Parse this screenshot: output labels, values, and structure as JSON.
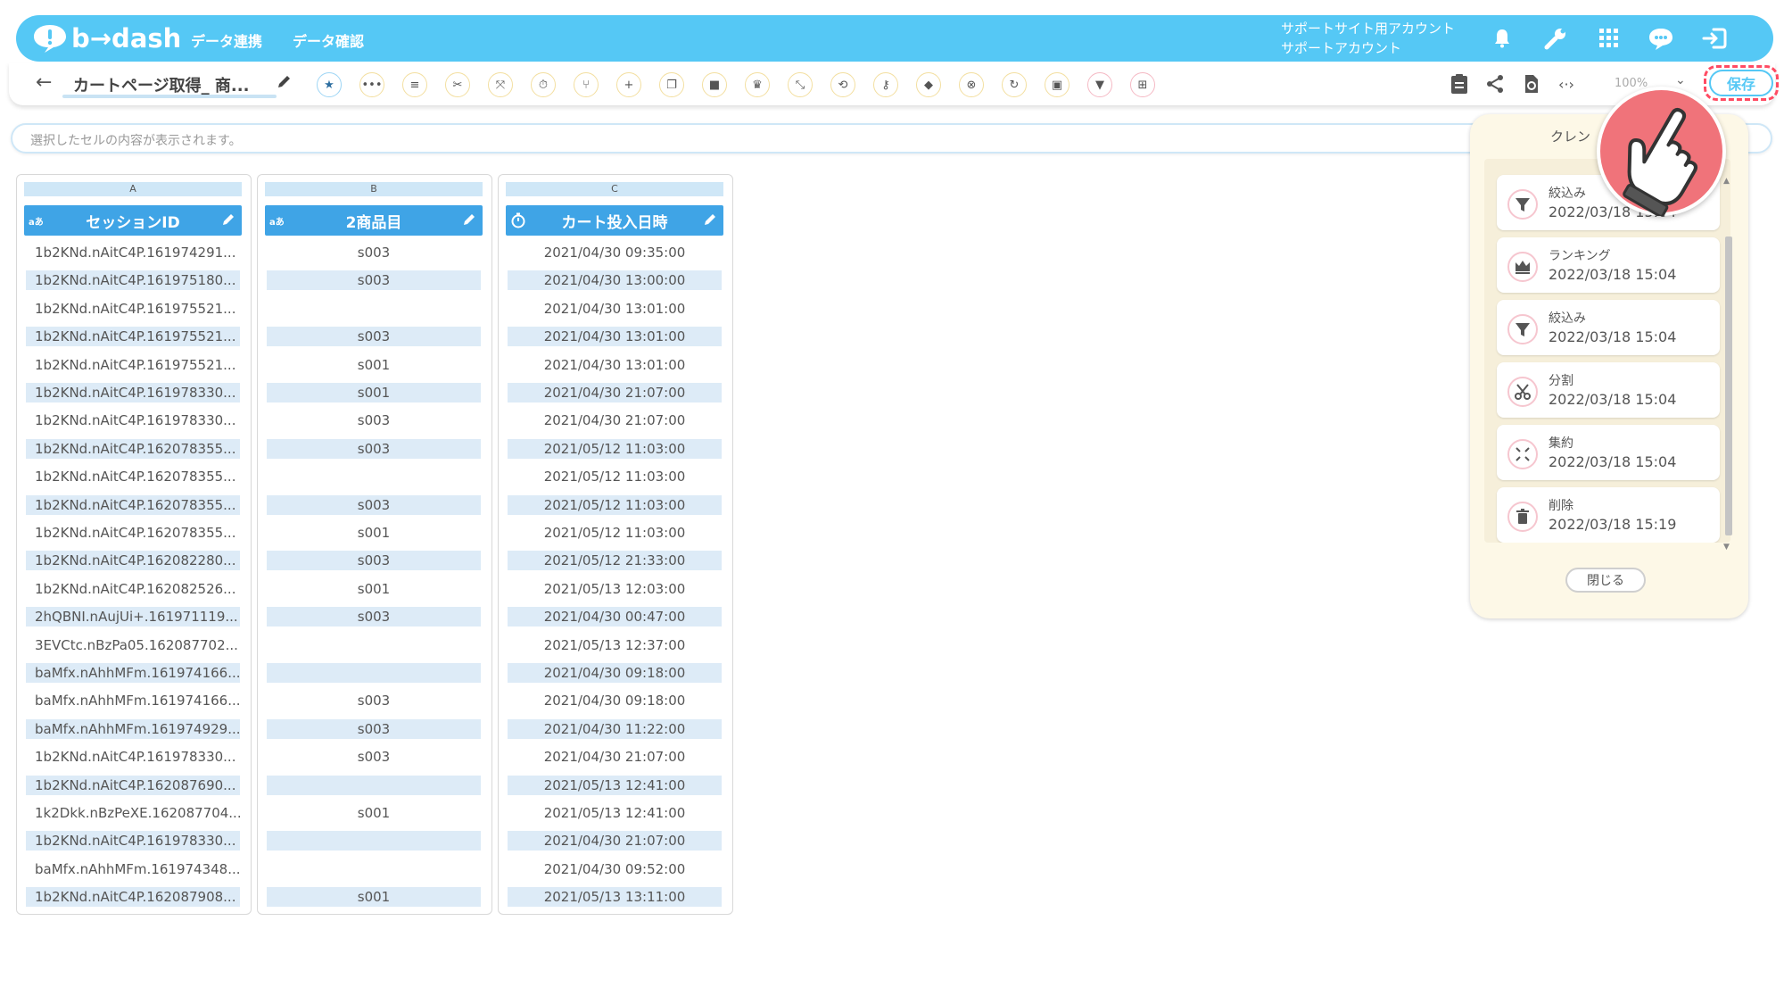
{
  "header": {
    "logo_text": "b→dash",
    "nav": [
      "データ連携",
      "データ確認"
    ],
    "account_line1": "サポートサイト用アカウント",
    "account_line2": "サポートアカウント",
    "icons": [
      "bell-icon",
      "wrench-icon",
      "grid-icon",
      "chat-icon",
      "logout-icon"
    ]
  },
  "toolbar": {
    "page_title": "カートページ取得_ 商...",
    "buttons": [
      "star-icon",
      "more-icon",
      "list-icon",
      "split-icon",
      "aggregate-icon",
      "timer-icon",
      "merge-icon",
      "add-icon",
      "copy-icon",
      "trash-icon",
      "crown-icon",
      "collapse-icon",
      "repeat-icon",
      "key-icon",
      "box-icon",
      "cancel-icon",
      "loop-icon",
      "frame-icon",
      "filter-icon",
      "pivot-icon"
    ],
    "right_icons": [
      "clipboard-icon",
      "share-icon",
      "refresh-icon",
      "code-icon"
    ],
    "zoom": "100%",
    "save_label": "保存"
  },
  "cell_bar": {
    "placeholder": "選択したセルの内容が表示されます。"
  },
  "columns": [
    {
      "letter": "A",
      "type": "aあ",
      "name": "セッションID"
    },
    {
      "letter": "B",
      "type": "aあ",
      "name": "2商品目"
    },
    {
      "letter": "C",
      "type": "timer",
      "name": "カート投入日時"
    }
  ],
  "rows": [
    [
      "1b2KNd.nAitC4P.161974291...",
      "s003",
      "2021/04/30 09:35:00"
    ],
    [
      "1b2KNd.nAitC4P.161975180...",
      "s003",
      "2021/04/30 13:00:00"
    ],
    [
      "1b2KNd.nAitC4P.161975521...",
      "",
      "2021/04/30 13:01:00"
    ],
    [
      "1b2KNd.nAitC4P.161975521...",
      "s003",
      "2021/04/30 13:01:00"
    ],
    [
      "1b2KNd.nAitC4P.161975521...",
      "s001",
      "2021/04/30 13:01:00"
    ],
    [
      "1b2KNd.nAitC4P.161978330...",
      "s001",
      "2021/04/30 21:07:00"
    ],
    [
      "1b2KNd.nAitC4P.161978330...",
      "s003",
      "2021/04/30 21:07:00"
    ],
    [
      "1b2KNd.nAitC4P.162078355...",
      "s003",
      "2021/05/12 11:03:00"
    ],
    [
      "1b2KNd.nAitC4P.162078355...",
      "",
      "2021/05/12 11:03:00"
    ],
    [
      "1b2KNd.nAitC4P.162078355...",
      "s003",
      "2021/05/12 11:03:00"
    ],
    [
      "1b2KNd.nAitC4P.162078355...",
      "s001",
      "2021/05/12 11:03:00"
    ],
    [
      "1b2KNd.nAitC4P.162082280...",
      "s003",
      "2021/05/12 21:33:00"
    ],
    [
      "1b2KNd.nAitC4P.162082526...",
      "s001",
      "2021/05/13 12:03:00"
    ],
    [
      "2hQBNI.nAujUi+.161971119...",
      "s003",
      "2021/04/30 00:47:00"
    ],
    [
      "3EVCtc.nBzPa05.162087702...",
      "",
      "2021/05/13 12:37:00"
    ],
    [
      "baMfx.nAhhMFm.161974166...",
      "",
      "2021/04/30 09:18:00"
    ],
    [
      "baMfx.nAhhMFm.161974166...",
      "s003",
      "2021/04/30 09:18:00"
    ],
    [
      "baMfx.nAhhMFm.161974929...",
      "s003",
      "2021/04/30 11:22:00"
    ],
    [
      "1b2KNd.nAitC4P.161978330...",
      "s003",
      "2021/04/30 21:07:00"
    ],
    [
      "1b2KNd.nAitC4P.162087690...",
      "",
      "2021/05/13 12:41:00"
    ],
    [
      "1k2Dkk.nBzPeXE.162087704...",
      "s001",
      "2021/05/13 12:41:00"
    ],
    [
      "1b2KNd.nAitC4P.161978330...",
      "",
      "2021/04/30 21:07:00"
    ],
    [
      "baMfx.nAhhMFm.161974348...",
      "",
      "2021/04/30 09:52:00"
    ],
    [
      "1b2KNd.nAitC4P.162087908...",
      "s001",
      "2021/05/13 13:11:00"
    ]
  ],
  "history_panel": {
    "title": "クレン",
    "items": [
      {
        "name": "絞込み",
        "date": "2022/03/18 15:04",
        "icon": "filter-icon"
      },
      {
        "name": "ランキング",
        "date": "2022/03/18 15:04",
        "icon": "crown-icon"
      },
      {
        "name": "絞込み",
        "date": "2022/03/18 15:04",
        "icon": "filter-icon"
      },
      {
        "name": "分割",
        "date": "2022/03/18 15:04",
        "icon": "split-icon"
      },
      {
        "name": "集約",
        "date": "2022/03/18 15:04",
        "icon": "aggregate-icon"
      },
      {
        "name": "削除",
        "date": "2022/03/18 15:19",
        "icon": "trash-icon"
      }
    ],
    "close_label": "閉じる"
  },
  "overlay": {
    "icon": "pointing-hand-icon"
  }
}
